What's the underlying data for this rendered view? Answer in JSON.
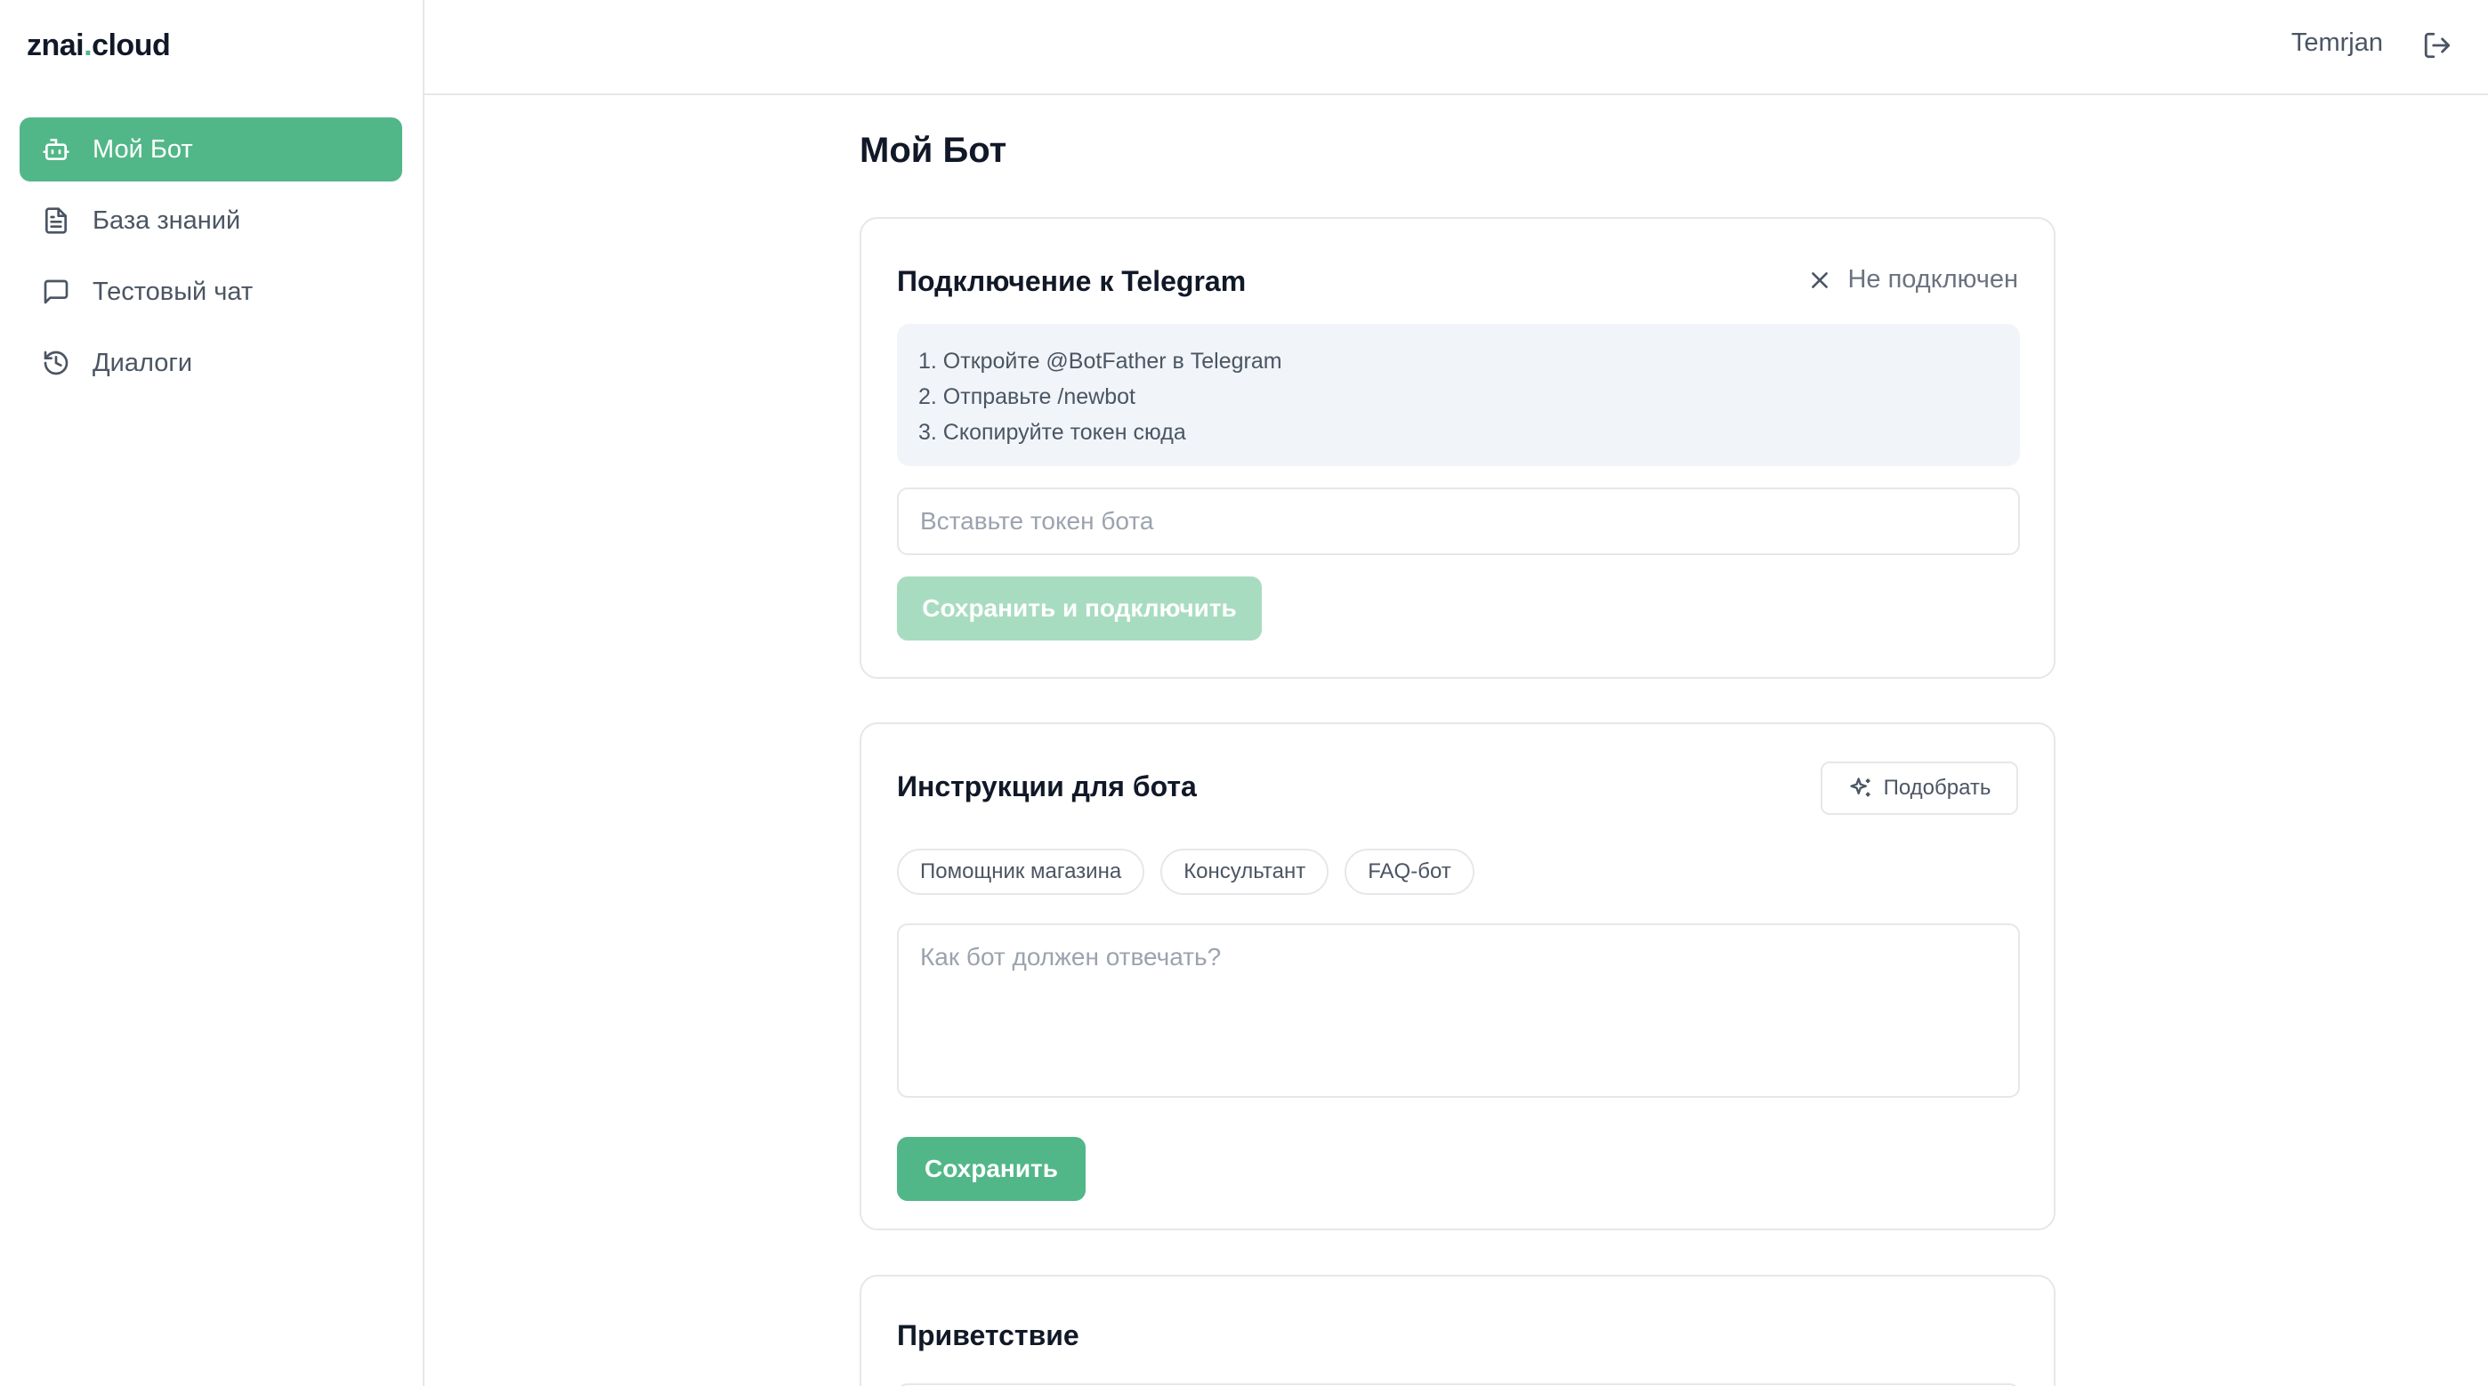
{
  "brand": {
    "name_part1": "znai",
    "dot": ".",
    "name_part2": "cloud"
  },
  "sidebar": {
    "items": [
      {
        "label": "Мой Бот",
        "icon": "bot-icon",
        "active": true
      },
      {
        "label": "База знаний",
        "icon": "document-icon",
        "active": false
      },
      {
        "label": "Тестовый чат",
        "icon": "chat-bubble-icon",
        "active": false
      },
      {
        "label": "Диалоги",
        "icon": "history-icon",
        "active": false
      }
    ]
  },
  "header": {
    "user_name": "Temrjan",
    "logout_icon": "logout-icon"
  },
  "main": {
    "title": "Мой Бот",
    "telegram": {
      "title": "Подключение к Telegram",
      "status": "Не подключен",
      "status_icon": "close-icon",
      "steps": [
        "1. Откройте @BotFather в Telegram",
        "2. Отправьте /newbot",
        "3. Скопируйте токен сюда"
      ],
      "token_placeholder": "Вставьте токен бота",
      "connect_button": "Сохранить и подключить"
    },
    "instructions": {
      "title": "Инструкции для бота",
      "pick_button": "Подобрать",
      "pick_icon": "sparkles-icon",
      "chips": [
        "Помощник магазина",
        "Консультант",
        "FAQ-бот"
      ],
      "placeholder": "Как бот должен отвечать?",
      "save_button": "Сохранить"
    },
    "greeting": {
      "title": "Приветствие"
    }
  },
  "colors": {
    "accent": "#52b788",
    "accent_disabled": "#a8dcc0",
    "border": "#e5e7eb",
    "muted_bg": "#f1f5f9"
  }
}
